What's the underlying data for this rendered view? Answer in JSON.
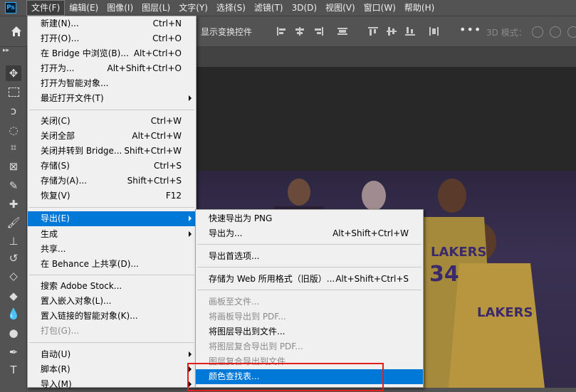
{
  "app": {
    "logo": "Ps"
  },
  "menubar": [
    {
      "label": "文件(F)",
      "active": true
    },
    {
      "label": "编辑(E)"
    },
    {
      "label": "图像(I)"
    },
    {
      "label": "图层(L)"
    },
    {
      "label": "文字(Y)"
    },
    {
      "label": "选择(S)"
    },
    {
      "label": "滤镜(T)"
    },
    {
      "label": "3D(D)"
    },
    {
      "label": "视图(V)"
    },
    {
      "label": "窗口(W)"
    },
    {
      "label": "帮助(H)"
    }
  ],
  "options_bar": {
    "show_transform": "显示变换控件",
    "more": "•••",
    "mode_3d": "3D 模式："
  },
  "file_menu": [
    {
      "label": "新建(N)...",
      "shortcut": "Ctrl+N"
    },
    {
      "label": "打开(O)...",
      "shortcut": "Ctrl+O"
    },
    {
      "label": "在 Bridge 中浏览(B)...",
      "shortcut": "Alt+Ctrl+O"
    },
    {
      "label": "打开为...",
      "shortcut": "Alt+Shift+Ctrl+O"
    },
    {
      "label": "打开为智能对象...",
      "shortcut": ""
    },
    {
      "label": "最近打开文件(T)",
      "shortcut": "",
      "submenu": true
    },
    {
      "label": "关闭(C)",
      "shortcut": "Ctrl+W"
    },
    {
      "label": "关闭全部",
      "shortcut": "Alt+Ctrl+W"
    },
    {
      "label": "关闭并转到 Bridge...",
      "shortcut": "Shift+Ctrl+W"
    },
    {
      "label": "存储(S)",
      "shortcut": "Ctrl+S"
    },
    {
      "label": "存储为(A)...",
      "shortcut": "Shift+Ctrl+S"
    },
    {
      "label": "恢复(V)",
      "shortcut": "F12"
    },
    {
      "label": "导出(E)",
      "shortcut": "",
      "submenu": true,
      "highlighted": true
    },
    {
      "label": "生成",
      "shortcut": "",
      "submenu": true
    },
    {
      "label": "共享...",
      "shortcut": ""
    },
    {
      "label": "在 Behance 上共享(D)...",
      "shortcut": ""
    },
    {
      "label": "搜索 Adobe Stock...",
      "shortcut": ""
    },
    {
      "label": "置入嵌入对象(L)...",
      "shortcut": ""
    },
    {
      "label": "置入链接的智能对象(K)...",
      "shortcut": ""
    },
    {
      "label": "打包(G)...",
      "shortcut": "",
      "disabled": true
    },
    {
      "label": "自动(U)",
      "shortcut": "",
      "submenu": true
    },
    {
      "label": "脚本(R)",
      "shortcut": "",
      "submenu": true
    },
    {
      "label": "导入(M)",
      "shortcut": "",
      "submenu": true
    }
  ],
  "export_menu": [
    {
      "label": "快速导出为 PNG",
      "shortcut": ""
    },
    {
      "label": "导出为...",
      "shortcut": "Alt+Shift+Ctrl+W"
    },
    {
      "label": "导出首选项...",
      "shortcut": ""
    },
    {
      "label": "存储为 Web 所用格式（旧版）...",
      "shortcut": "Alt+Shift+Ctrl+S"
    },
    {
      "label": "画板至文件...",
      "shortcut": "",
      "disabled": true
    },
    {
      "label": "将画板导出到 PDF...",
      "shortcut": "",
      "disabled": true
    },
    {
      "label": "将图层导出到文件...",
      "shortcut": ""
    },
    {
      "label": "将图层复合导出到 PDF...",
      "shortcut": "",
      "disabled": true
    },
    {
      "label": "图层复合导出到文件...",
      "shortcut": "",
      "disabled": true
    },
    {
      "label": "颜色查找表...",
      "shortcut": "",
      "highlighted": true
    }
  ],
  "colors": {
    "highlight": "#0078d7",
    "annotation_box": "#e0201c",
    "ps_blue": "#31a8ff"
  }
}
